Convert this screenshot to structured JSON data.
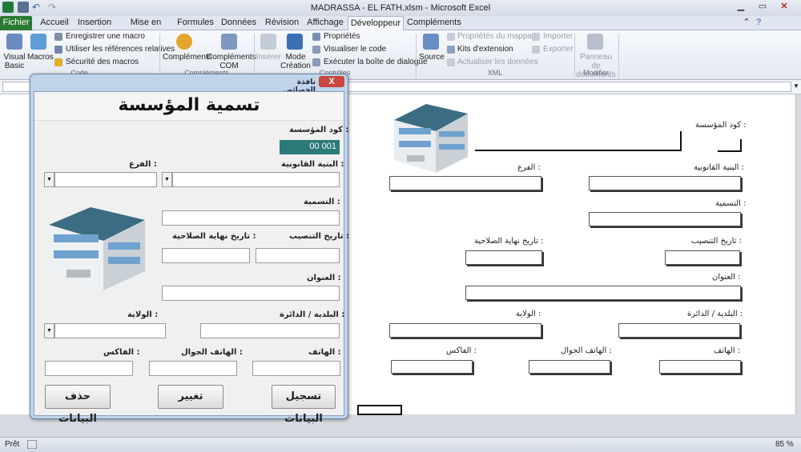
{
  "window": {
    "title": "MADRASSA - EL FATH.xlsm  -  Microsoft Excel"
  },
  "tabs": [
    "Fichier",
    "Accueil",
    "Insertion",
    "Mise en page",
    "Formules",
    "Données",
    "Révision",
    "Affichage",
    "Développeur",
    "Compléments"
  ],
  "ribbon": {
    "visual_basic": "Visual Basic",
    "macros": "Macros",
    "record_macro": "Enregistrer une macro",
    "relative_refs": "Utiliser les références relatives",
    "macro_security": "Sécurité des macros",
    "group_code": "Code",
    "addins": "Compléments",
    "com_addins": "Compléments COM",
    "group_addins": "Compléments",
    "insert": "Insérer",
    "design_mode": "Mode Création",
    "properties": "Propriétés",
    "view_code": "Visualiser le code",
    "run_dialog": "Exécuter la boîte de dialogue",
    "group_controls": "Contrôles",
    "source": "Source",
    "map_props": "Propriétés du mappage",
    "expansion_packs": "Kits d'extension",
    "refresh_data": "Actualiser les données",
    "import": "Importer",
    "export": "Exporter",
    "group_xml": "XML",
    "doc_panel": "Panneau de documents",
    "group_modify": "Modifier"
  },
  "status": {
    "ready": "Prêt",
    "zoom": "85 %"
  },
  "sheet": {
    "code_label": "كود المؤسسة :",
    "legal_label": "البنية القانونية :",
    "branch_label": "الفرع :",
    "name_label": "التسمية :",
    "install_date_label": "تاريخ التنصيب :",
    "expiry_date_label": "تاريخ نهاية الصلاحية :",
    "address_label": "العنوان :",
    "municipality_label": "البلدية / الدائرة :",
    "wilaya_label": "الولاية :",
    "phone_label": "الهاتف :",
    "mobile_label": "الهاتف الجوال :",
    "fax_label": "الفاكس :"
  },
  "dialog": {
    "caption": "نافذة الخصائص",
    "close": "X",
    "heading": "تسمية المؤسسة",
    "code_label": "كود المؤسسة :",
    "code_value": "00 001",
    "legal_label": "البنية القانونية :",
    "branch_label": "الفرع :",
    "name_label": "التسمية :",
    "install_date_label": "تاريخ التنصيب :",
    "expiry_date_label": "تاريخ نهاية الصلاحية :",
    "address_label": "العنوان :",
    "municipality_label": "البلدية / الدائرة :",
    "wilaya_label": "الولاية :",
    "phone_label": "الهاتف :",
    "mobile_label": "الهاتف الجوال :",
    "fax_label": "الفاكس :",
    "save_button": "تسجيل البيانات",
    "modify_button": "تغيير",
    "delete_button": "حذف البيانات",
    "accent_color": "#2b7a78"
  }
}
